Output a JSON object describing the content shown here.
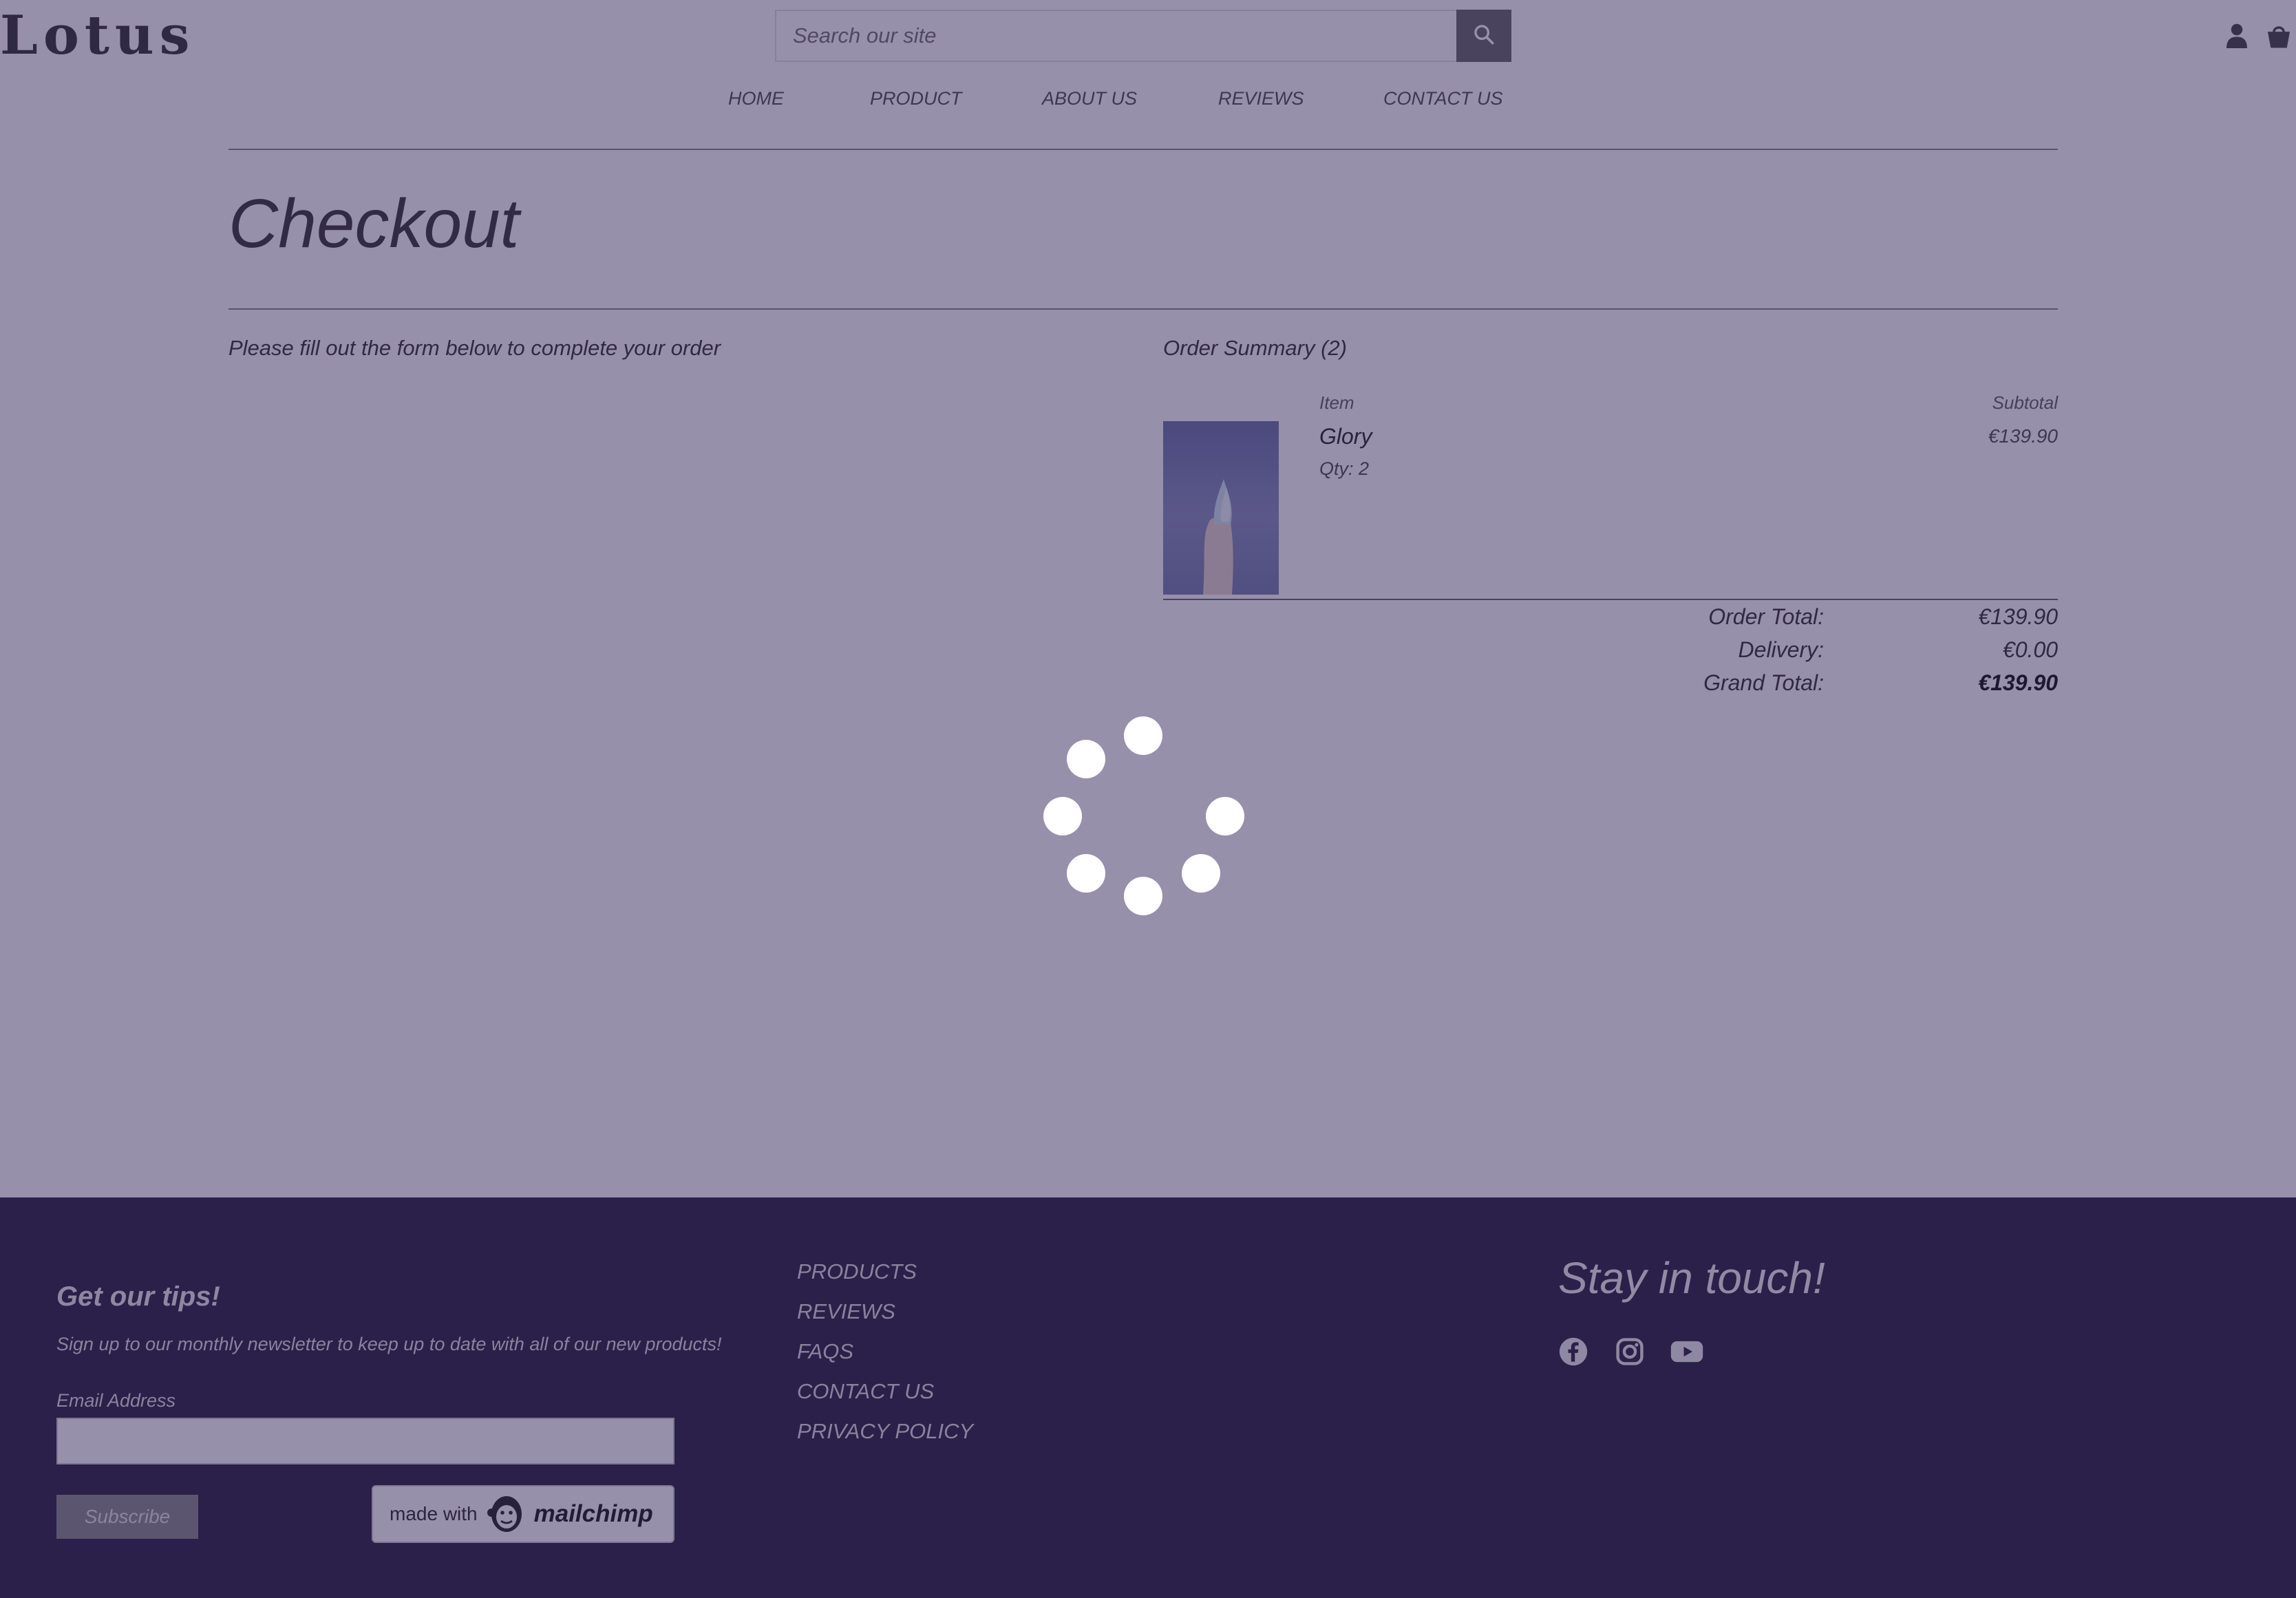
{
  "header": {
    "logo": "Lotus",
    "search": {
      "placeholder": "Search our site"
    },
    "icons": [
      "search-icon",
      "user-icon",
      "shopping-bag-icon"
    ]
  },
  "nav": {
    "items": [
      {
        "label": "HOME"
      },
      {
        "label": "PRODUCT"
      },
      {
        "label": "ABOUT US"
      },
      {
        "label": "REVIEWS"
      },
      {
        "label": "CONTACT US"
      }
    ]
  },
  "main": {
    "title": "Checkout",
    "form_intro": "Please fill out the form below to complete your order"
  },
  "summary": {
    "title": "Order Summary (2)",
    "col_item": "Item",
    "col_subtotal": "Subtotal",
    "item": {
      "name": "Glory",
      "qty": "Qty: 2",
      "price": "€139.90"
    },
    "order_total_label": "Order Total:",
    "order_total": "€139.90",
    "delivery_label": "Delivery:",
    "delivery": "€0.00",
    "grand_total_label": "Grand Total:",
    "grand_total": "€139.90"
  },
  "footer": {
    "newsletter_title": "Get our tips!",
    "newsletter_sub": "Sign up to our monthly newsletter to keep up to date with all of our new products!",
    "email_label": "Email Address",
    "subscribe": "Subscribe",
    "mailchimp_made": "made with",
    "mailchimp_name": "mailchimp",
    "links": [
      {
        "label": "PRODUCTS"
      },
      {
        "label": "REVIEWS"
      },
      {
        "label": "FAQS"
      },
      {
        "label": "CONTACT US"
      },
      {
        "label": "PRIVACY POLICY"
      }
    ],
    "stay_title": "Stay in touch!",
    "social_icons": [
      "facebook-icon",
      "instagram-icon",
      "youtube-icon"
    ]
  },
  "overlay": {
    "color": "#261650",
    "state": "loading"
  }
}
